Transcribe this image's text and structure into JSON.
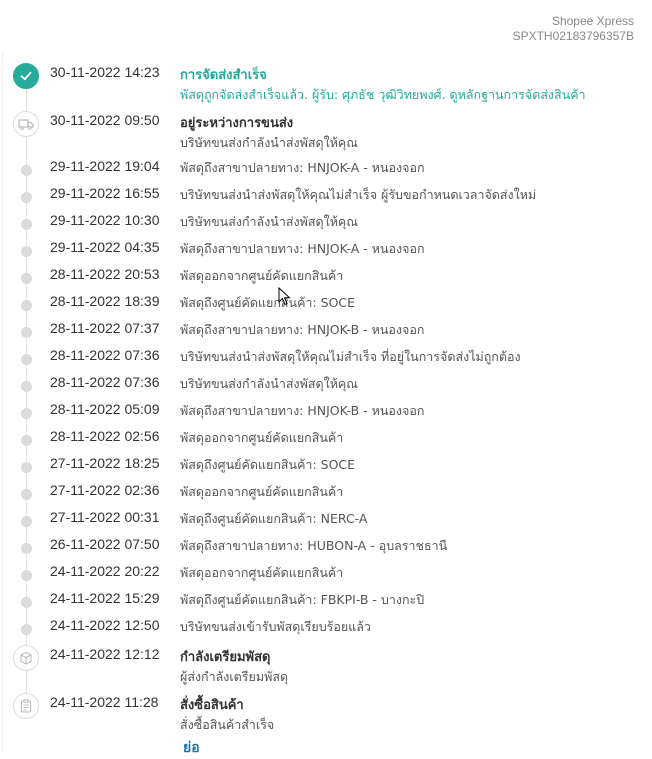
{
  "carrier": {
    "name": "Shopee Xpress",
    "tracking": "SPXTH02183796357B"
  },
  "colors": {
    "accent": "#26aa99",
    "link": "#1a73b6",
    "dot": "#dbdbdb"
  },
  "events": [
    {
      "time": "30-11-2022 14:23",
      "title": "การจัดส่งสำเร็จ",
      "text": "พัสดุถูกจัดส่งสำเร็จแล้ว. ผู้รับ: ศุภธัช วุฒิวิทยพงศ์.",
      "link": "ดูหลักฐานการจัดส่งสินค้า",
      "icon": "check-icon"
    },
    {
      "time": "30-11-2022 09:50",
      "title": "อยู่ระหว่างการขนส่ง",
      "text": "บริษัทขนส่งกำลังนำส่งพัสดุให้คุณ",
      "icon": "truck-icon"
    },
    {
      "time": "29-11-2022 19:04",
      "text": "พัสดุถึงสาขาปลายทาง: HNJOK-A - หนองจอก"
    },
    {
      "time": "29-11-2022 16:55",
      "text": "บริษัทขนส่งนำส่งพัสดุให้คุณไม่สำเร็จ ผู้รับขอกำหนดเวลาจัดส่งใหม่"
    },
    {
      "time": "29-11-2022 10:30",
      "text": "บริษัทขนส่งกำลังนำส่งพัสดุให้คุณ"
    },
    {
      "time": "29-11-2022 04:35",
      "text": "พัสดุถึงสาขาปลายทาง: HNJOK-A - หนองจอก"
    },
    {
      "time": "28-11-2022 20:53",
      "text": "พัสดุออกจากศูนย์คัดแยกสินค้า"
    },
    {
      "time": "28-11-2022 18:39",
      "text": "พัสดุถึงศูนย์คัดแยกสินค้า: SOCE"
    },
    {
      "time": "28-11-2022 07:37",
      "text": "พัสดุถึงสาขาปลายทาง: HNJOK-B - หนองจอก"
    },
    {
      "time": "28-11-2022 07:36",
      "text": "บริษัทขนส่งนำส่งพัสดุให้คุณไม่สำเร็จ ที่อยู่ในการจัดส่งไม่ถูกต้อง"
    },
    {
      "time": "28-11-2022 07:36",
      "text": "บริษัทขนส่งกำลังนำส่งพัสดุให้คุณ"
    },
    {
      "time": "28-11-2022 05:09",
      "text": "พัสดุถึงสาขาปลายทาง: HNJOK-B - หนองจอก"
    },
    {
      "time": "28-11-2022 02:56",
      "text": "พัสดุออกจากศูนย์คัดแยกสินค้า"
    },
    {
      "time": "27-11-2022 18:25",
      "text": "พัสดุถึงศูนย์คัดแยกสินค้า: SOCE"
    },
    {
      "time": "27-11-2022 02:36",
      "text": "พัสดุออกจากศูนย์คัดแยกสินค้า"
    },
    {
      "time": "27-11-2022 00:31",
      "text": "พัสดุถึงศูนย์คัดแยกสินค้า: NERC-A"
    },
    {
      "time": "26-11-2022 07:50",
      "text": "พัสดุถึงสาขาปลายทาง: HUBON-A - อุบลราชธานี"
    },
    {
      "time": "24-11-2022 20:22",
      "text": "พัสดุออกจากศูนย์คัดแยกสินค้า"
    },
    {
      "time": "24-11-2022 15:29",
      "text": "พัสดุถึงศูนย์คัดแยกสินค้า: FBKPI-B - บางกะปิ"
    },
    {
      "time": "24-11-2022 12:50",
      "text": "บริษัทขนส่งเข้ารับพัสดุเรียบร้อยแล้ว"
    },
    {
      "time": "24-11-2022 12:12",
      "title": "กำลังเตรียมพัสดุ",
      "text": "ผู้ส่งกำลังเตรียมพัสดุ",
      "icon": "package-icon"
    },
    {
      "time": "24-11-2022 11:28",
      "title": "สั่งซื้อสินค้า",
      "text": "สั่งซื้อสินค้าสำเร็จ",
      "icon": "clipboard-icon"
    }
  ],
  "collapse_label": "ย่อ"
}
